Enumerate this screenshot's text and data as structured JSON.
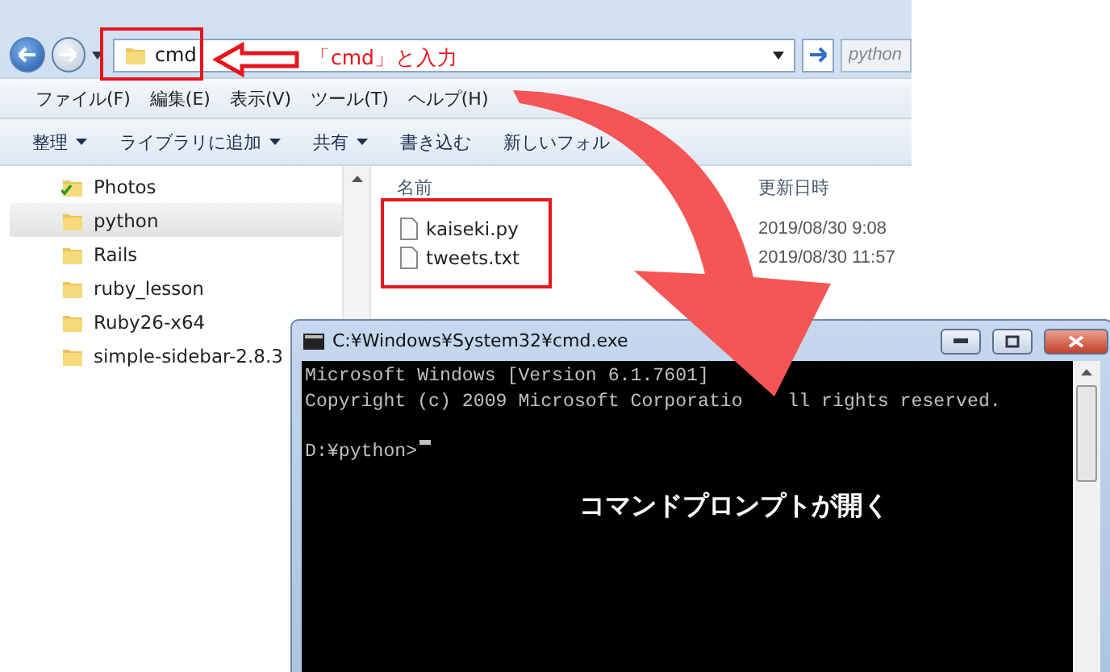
{
  "explorer": {
    "address": {
      "value": "cmd"
    },
    "search": {
      "placeholder": "python"
    },
    "menu": [
      "ファイル(F)",
      "編集(E)",
      "表示(V)",
      "ツール(T)",
      "ヘルプ(H)"
    ],
    "toolbar": [
      {
        "label": "整理",
        "dropdown": true
      },
      {
        "label": "ライブラリに追加",
        "dropdown": true
      },
      {
        "label": "共有",
        "dropdown": true
      },
      {
        "label": "書き込む",
        "dropdown": false
      },
      {
        "label": "新しいフォル",
        "dropdown": false
      }
    ],
    "nav_items": [
      {
        "label": "Photos",
        "kind": "synced",
        "selected": false
      },
      {
        "label": "python",
        "kind": "folder",
        "selected": true
      },
      {
        "label": "Rails",
        "kind": "folder",
        "selected": false
      },
      {
        "label": "ruby_lesson",
        "kind": "folder",
        "selected": false
      },
      {
        "label": "Ruby26-x64",
        "kind": "folder",
        "selected": false
      },
      {
        "label": "simple-sidebar-2.8.3",
        "kind": "folder",
        "selected": false
      }
    ],
    "columns": [
      "名前",
      "更新日時"
    ],
    "files": [
      {
        "name": "kaiseki.py",
        "modified": "2019/08/30 9:08"
      },
      {
        "name": "tweets.txt",
        "modified": "2019/08/30 11:57"
      }
    ]
  },
  "annotation": {
    "label": "「cmd」と入力"
  },
  "cmd": {
    "title": "C:¥Windows¥System32¥cmd.exe",
    "lines": [
      {
        "kind": "output",
        "segments": [
          "Microsoft Windows [Version 6.1.7601]"
        ]
      },
      {
        "kind": "output",
        "segments": [
          "Copyright (c) 2009 Microsoft Corporatio",
          "ll rights reserved."
        ]
      },
      {
        "kind": "prompt",
        "segments": [
          "D:¥python>"
        ]
      }
    ],
    "caption": "コマンドプロンプトが開く"
  }
}
